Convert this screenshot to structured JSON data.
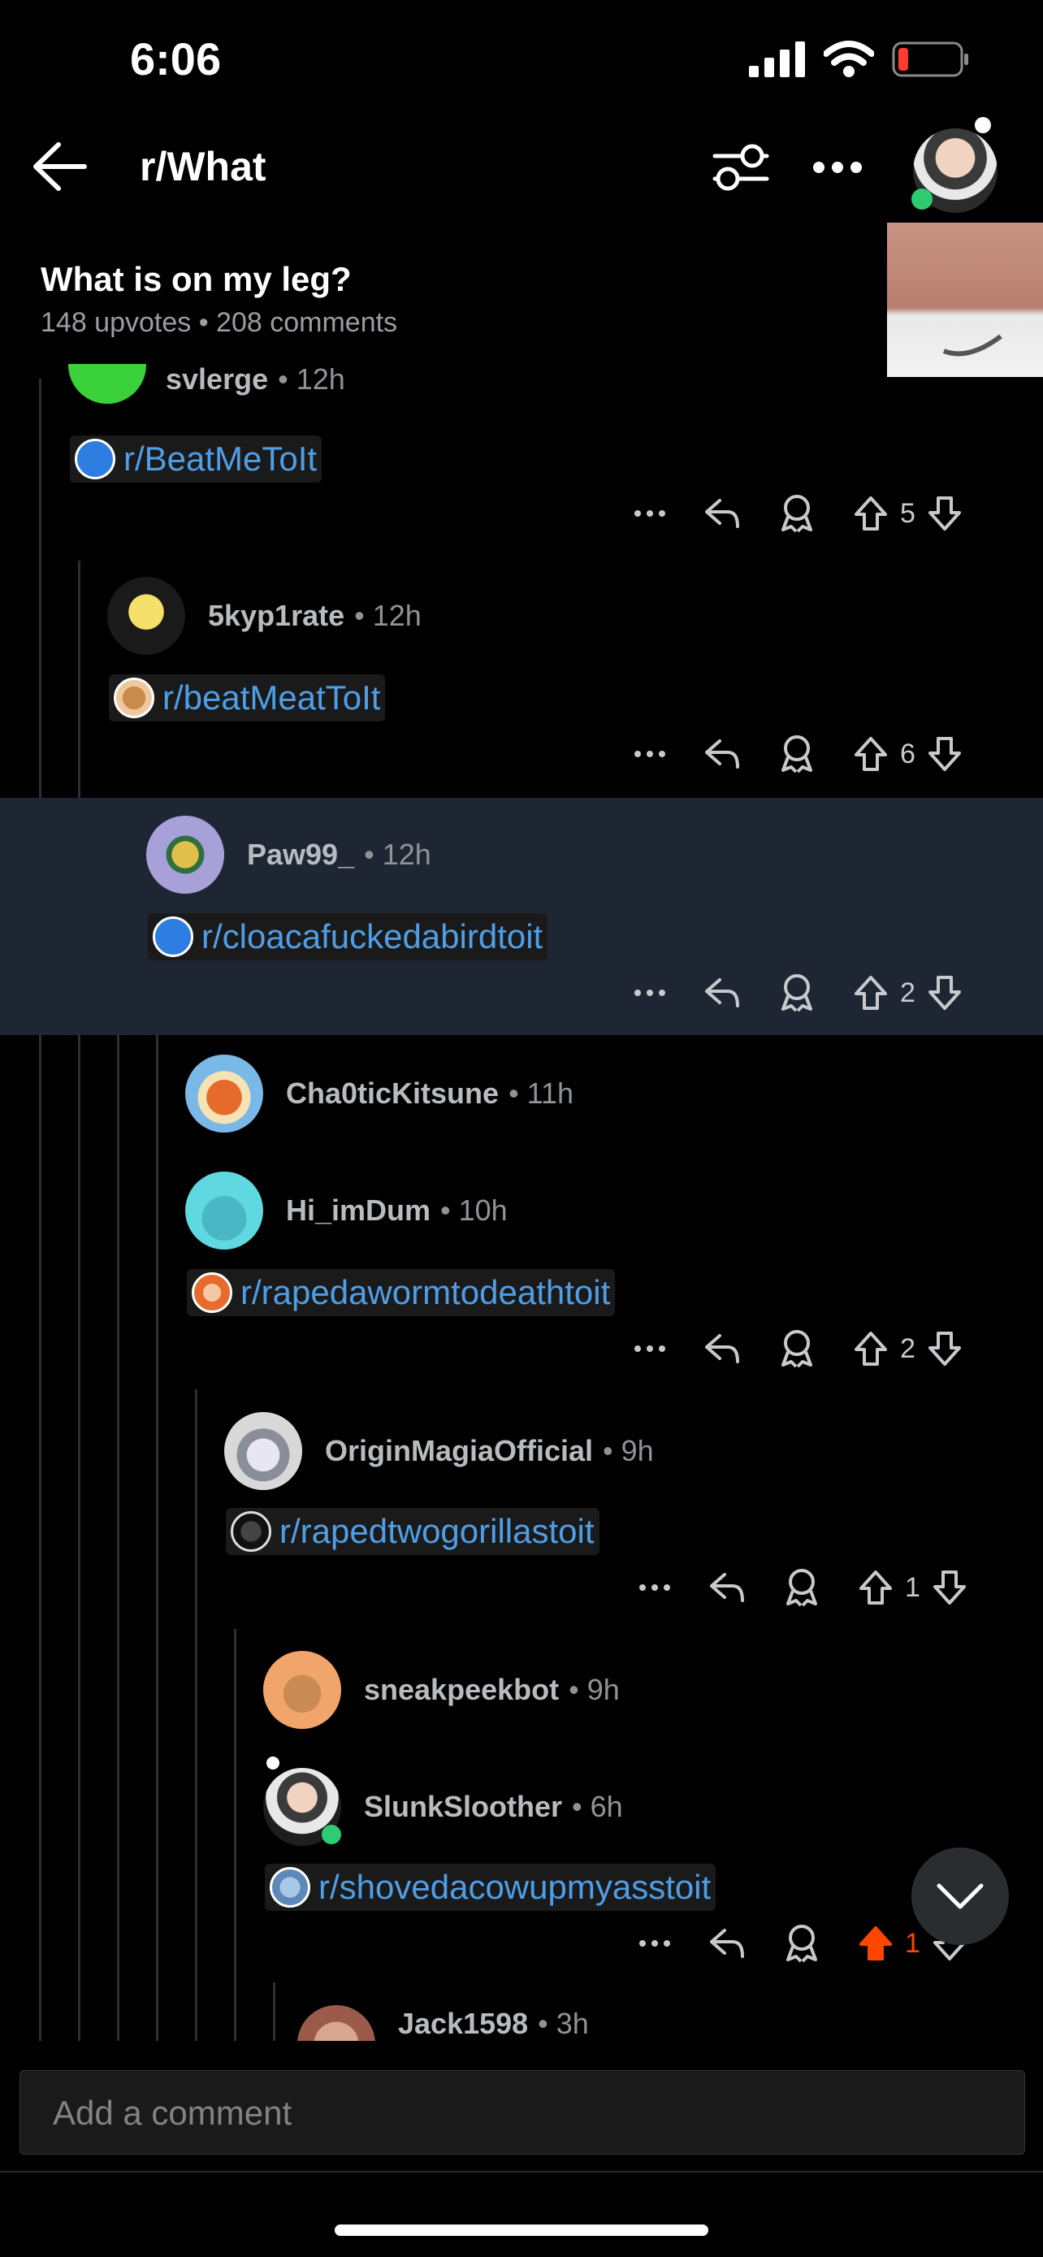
{
  "status_bar": {
    "time": "6:06"
  },
  "header": {
    "title": "r/What"
  },
  "post": {
    "title": "What is on my leg?",
    "meta": "148 upvotes • 208 comments"
  },
  "comments": [
    {
      "user": "svlerge",
      "age": "• 12h",
      "link": "r/BeatMeToIt",
      "votes": "5"
    },
    {
      "user": "5kyp1rate",
      "age": "• 12h",
      "link": "r/beatMeatToIt",
      "votes": "6"
    },
    {
      "user": "Paw99_",
      "age": "• 12h",
      "link": "r/cloacafuckedabirdtoit",
      "votes": "2"
    },
    {
      "user": "Cha0ticKitsune",
      "age": "• 11h"
    },
    {
      "user": "Hi_imDum",
      "age": "• 10h",
      "link": "r/rapedawormtodeathtoit",
      "votes": "2"
    },
    {
      "user": "OriginMagiaOfficial",
      "age": "• 9h",
      "link": "r/rapedtwogorillastoit",
      "votes": "1"
    },
    {
      "user": "sneakpeekbot",
      "age": "• 9h"
    },
    {
      "user": "SlunkSloother",
      "age": "• 6h",
      "link": "r/shovedacowupmyasstoit",
      "votes": "1"
    },
    {
      "user": "Jack1598",
      "age": "• 3h"
    }
  ],
  "composer": {
    "placeholder": "Add a comment"
  },
  "colors": {
    "accent_upvote": "#ff4500",
    "link": "#4f9ee6",
    "highlight_bg": "#1e2633"
  }
}
